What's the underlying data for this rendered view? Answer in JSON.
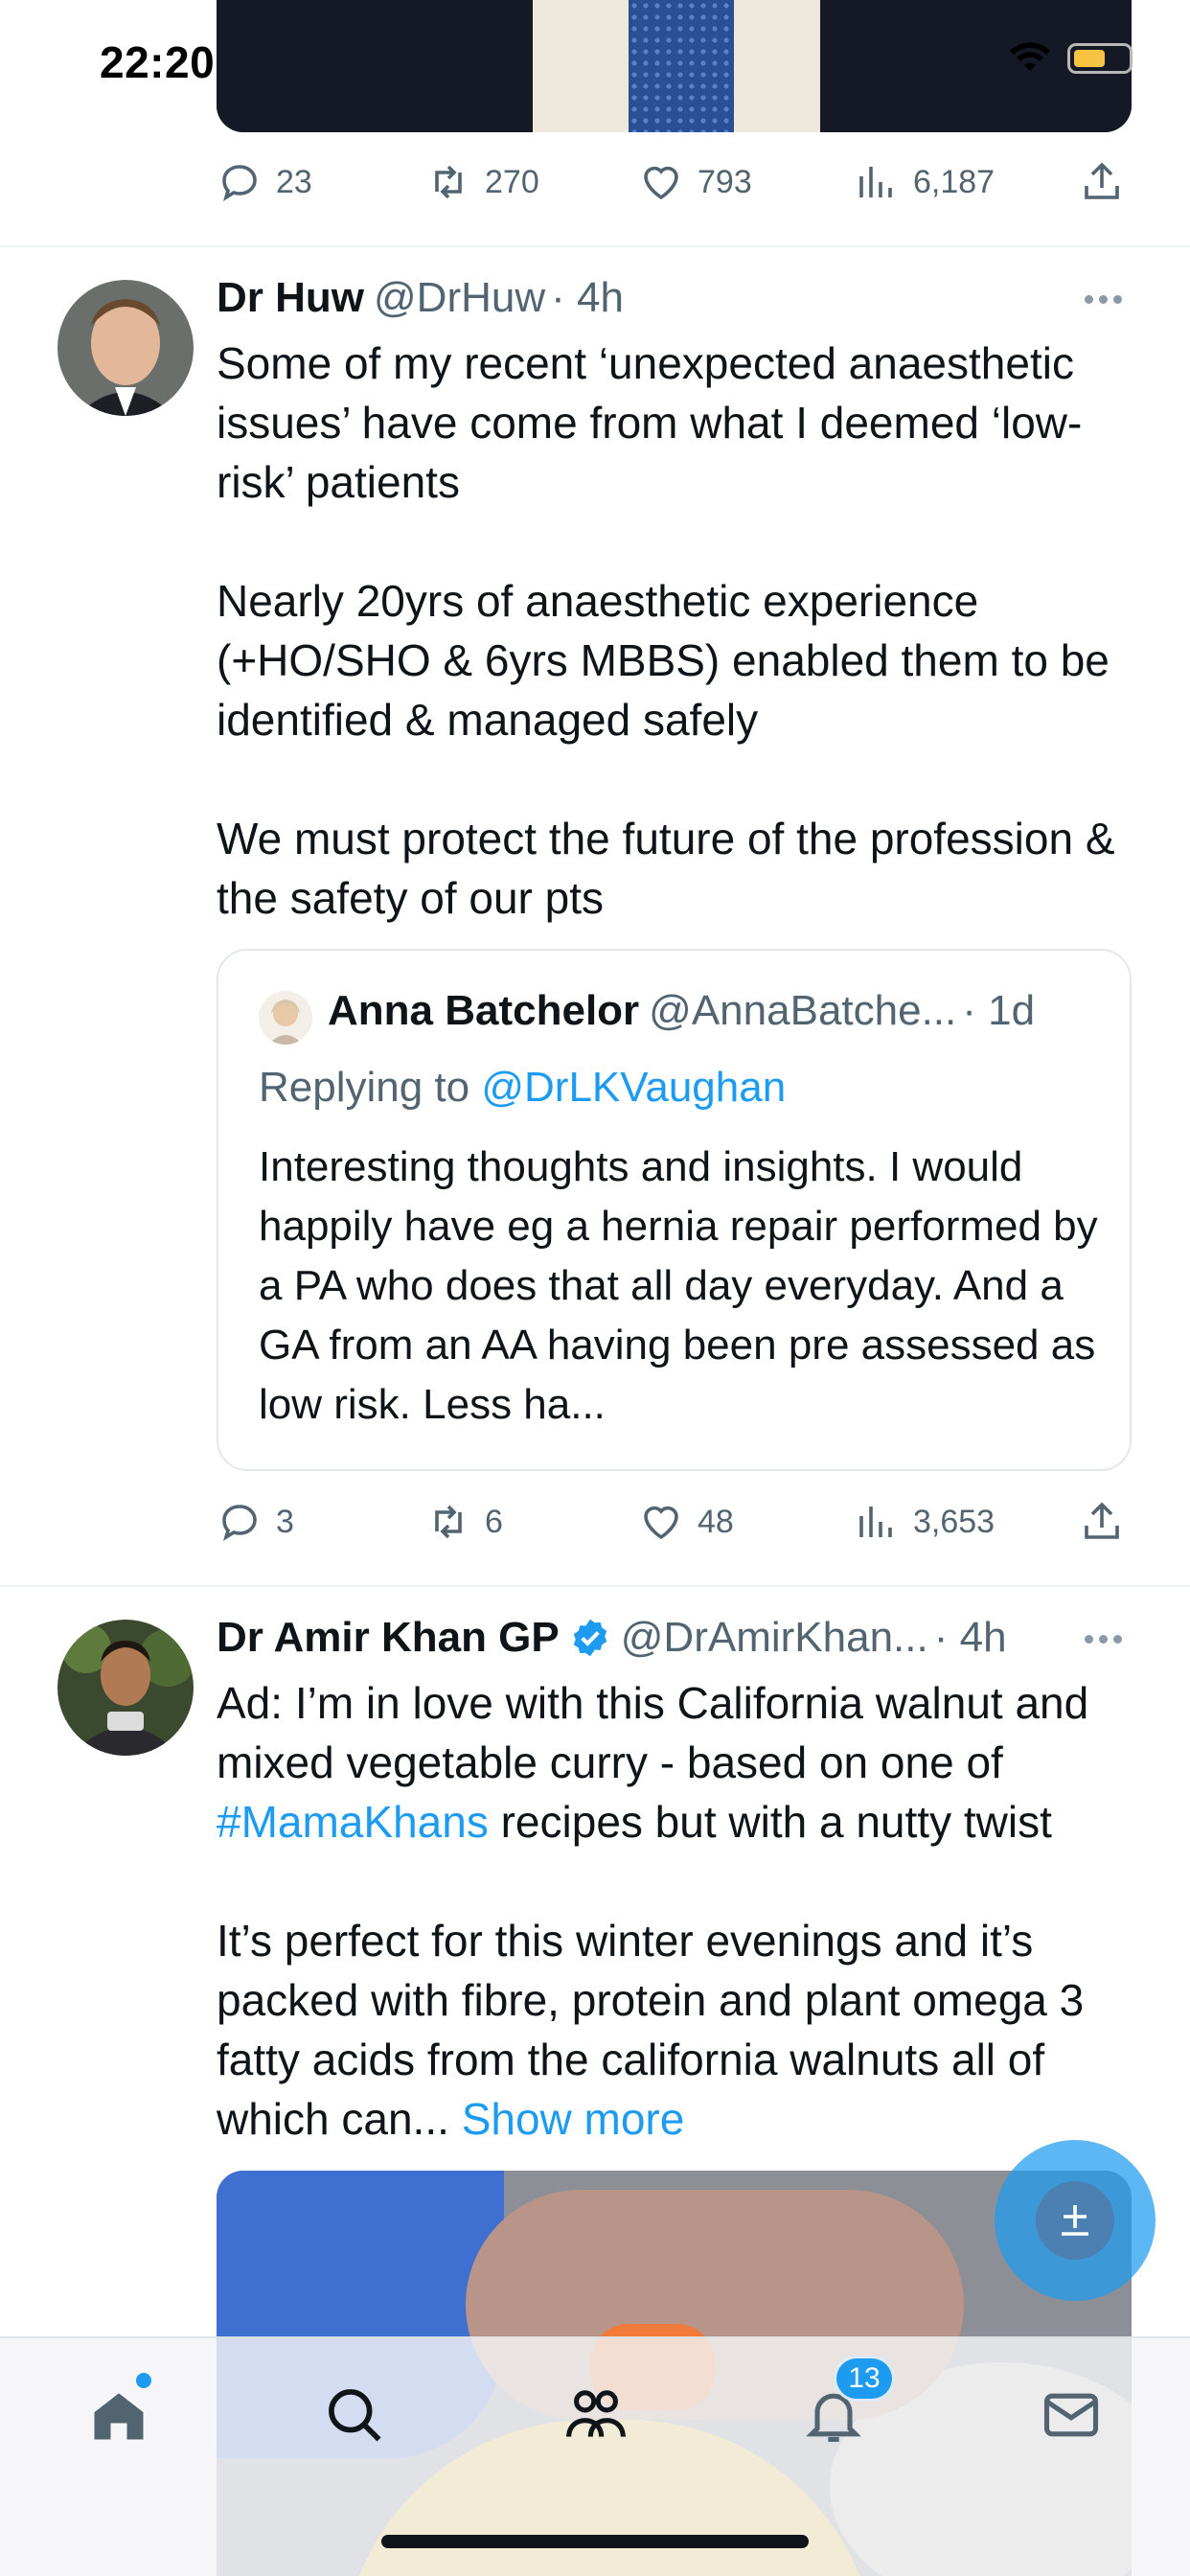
{
  "status_bar": {
    "time": "22:20"
  },
  "feed": {
    "tweet1_stats": {
      "replies": "23",
      "retweets": "270",
      "likes": "793",
      "views": "6,187"
    },
    "tweet2": {
      "name": "Dr Huw",
      "handle": "@DrHuw",
      "time": "· 4h",
      "text": "Some of my recent ‘unexpected anaesthetic issues’ have come from what I deemed ‘low-risk’ patients\n\nNearly 20yrs of anaesthetic experience (+HO/SHO & 6yrs MBBS) enabled them to be identified & managed safely\n\nWe must protect the future of the profession & the safety of our pts",
      "quote": {
        "name": "Anna Batchelor",
        "handle": "@AnnaBatche...",
        "time": "· 1d",
        "replying_prefix": "Replying to ",
        "replying_handle": "@DrLKVaughan",
        "text": "Interesting thoughts and insights. I would happily have eg a hernia repair performed by a PA who does that all day everyday. And a GA from an AA having been pre assessed as low risk. Less ha..."
      },
      "stats": {
        "replies": "3",
        "retweets": "6",
        "likes": "48",
        "views": "3,653"
      }
    },
    "tweet3": {
      "name": "Dr Amir Khan GP",
      "handle": "@DrAmirKhan...",
      "time": "· 4h",
      "text_1": "Ad: I’m in love with this California walnut and mixed vegetable curry - based on one of ",
      "hashtag": "#MamaKhans",
      "text_2": " recipes but with a nutty twist\n\nIt’s perfect for this winter evenings and it’s packed with fibre, protein and plant omega 3 fatty acids from the california walnuts all of which can... ",
      "show_more": "Show more"
    }
  },
  "tab_bar": {
    "items": [
      "home-icon",
      "search-icon",
      "communities-icon",
      "notifications-icon",
      "messages-icon"
    ],
    "notification_count": "13"
  },
  "colors": {
    "accent": "#1d9bf0",
    "verified": "#1d9bf0",
    "text_secondary": "#536471"
  }
}
